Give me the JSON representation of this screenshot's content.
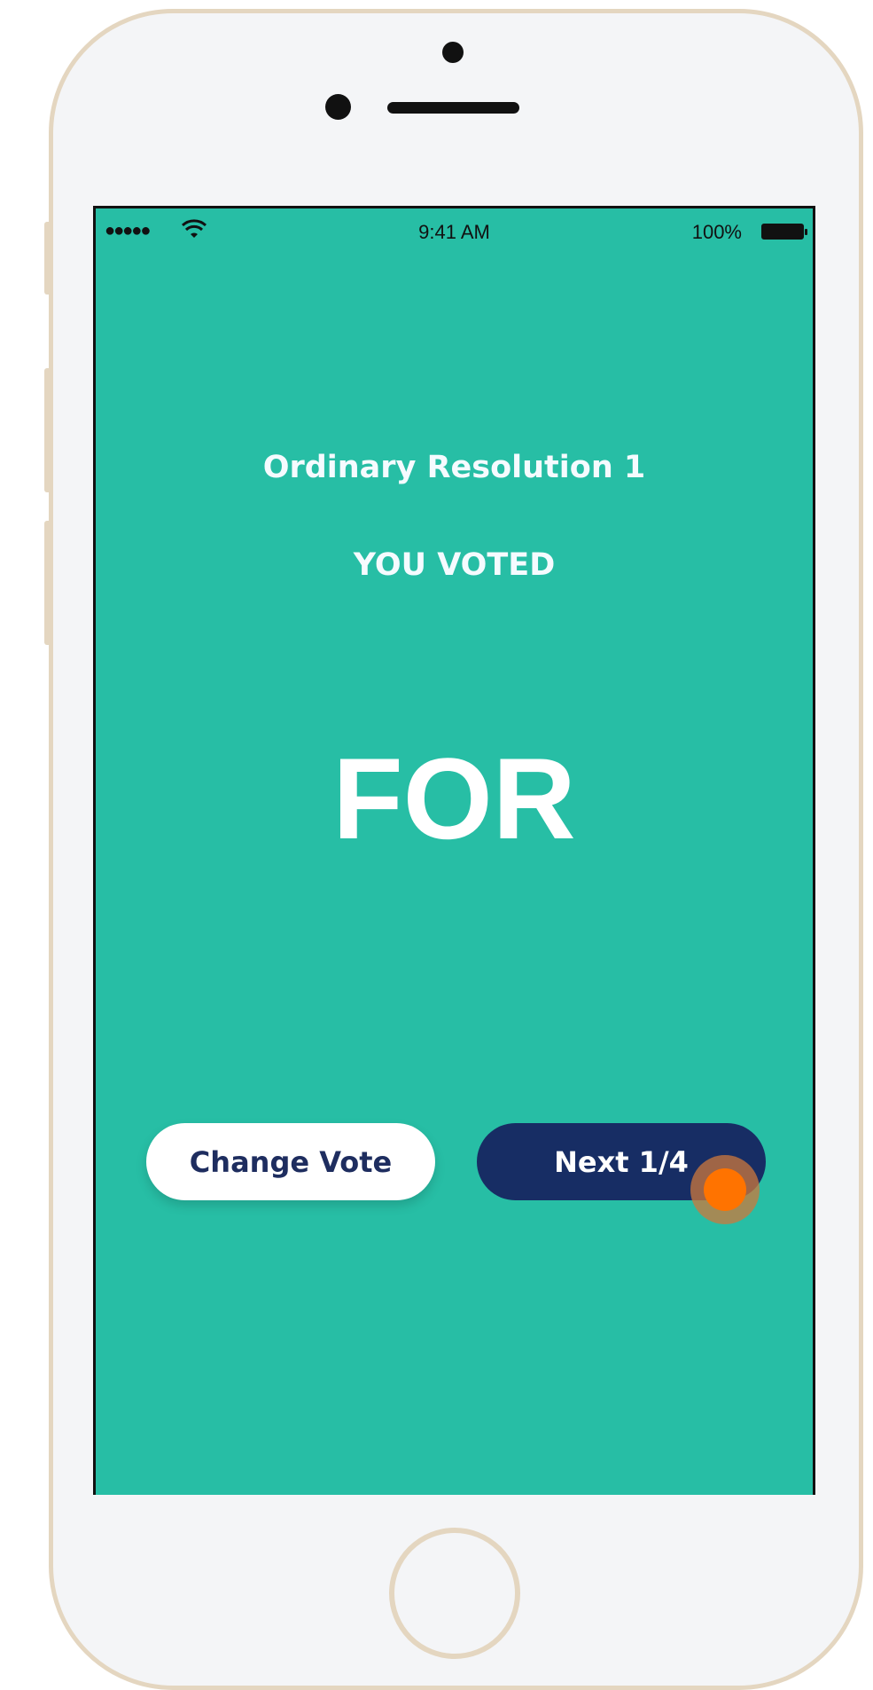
{
  "status_bar": {
    "signal": "●●●●●",
    "time": "9:41 AM",
    "battery": "100%"
  },
  "vote": {
    "title": "Ordinary Resolution 1",
    "subtitle": "YOU VOTED",
    "choice": "FOR"
  },
  "actions": {
    "change_vote_label": "Change Vote",
    "next_label": "Next 1/4"
  },
  "colors": {
    "screen_background": "#27bea5",
    "next_button": "#172d64",
    "touch_indicator": "#ff7300"
  },
  "icons": [
    "wifi-icon",
    "battery-icon",
    "touch-indicator-icon"
  ]
}
